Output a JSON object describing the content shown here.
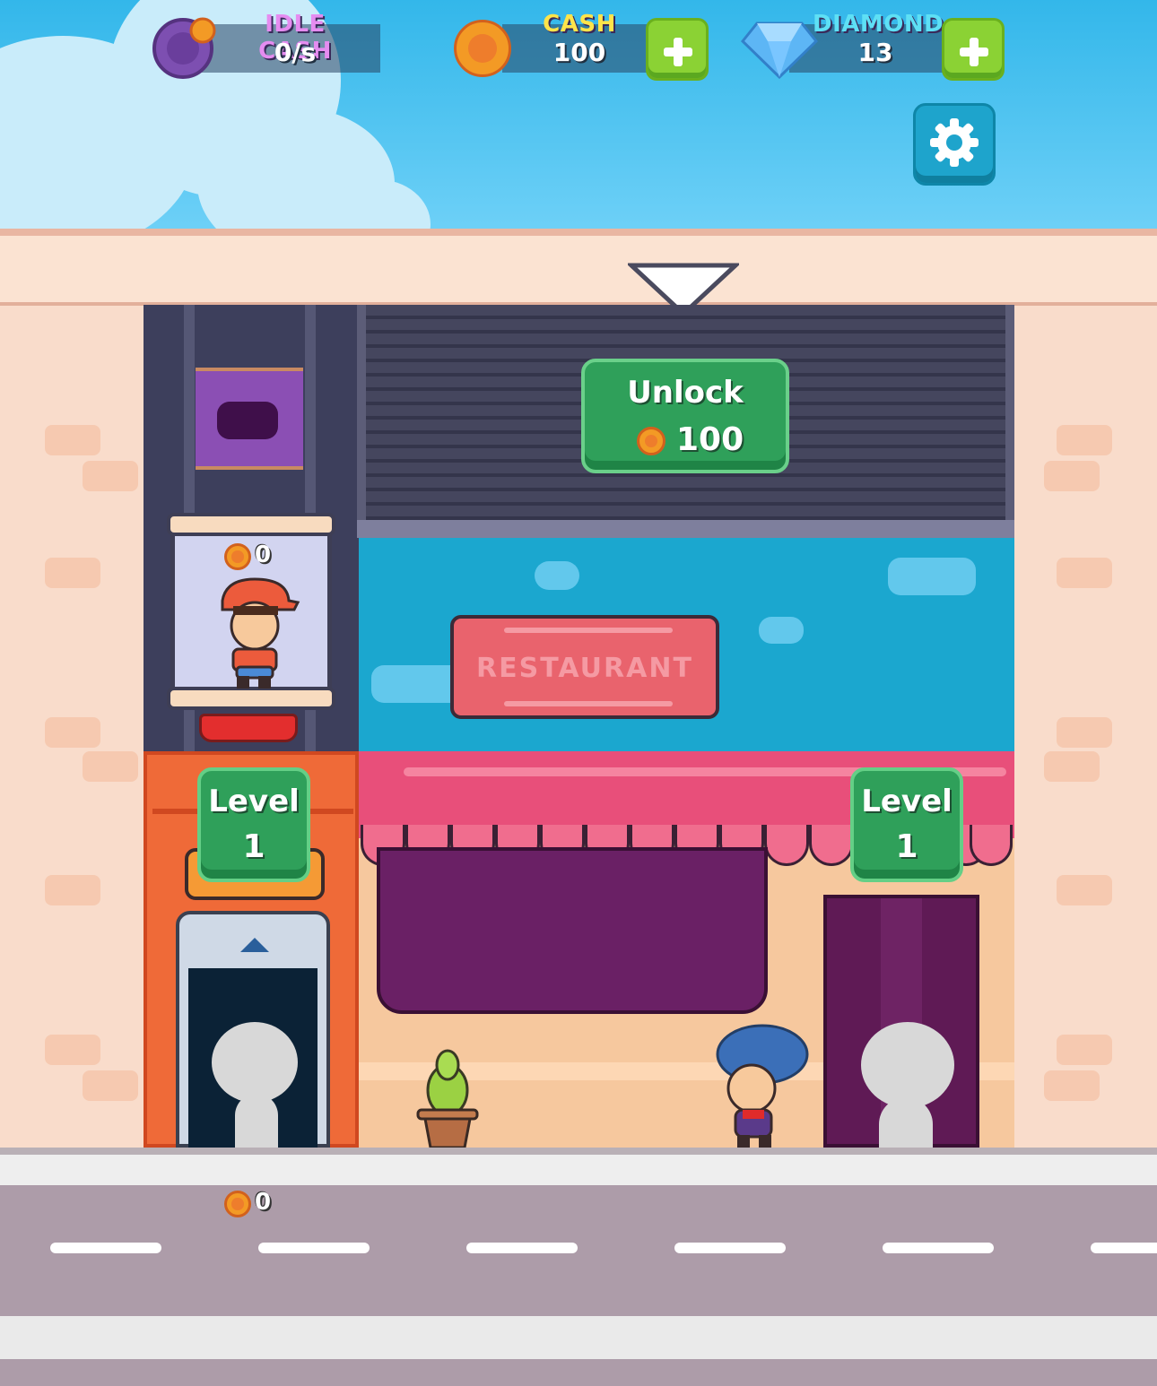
{
  "hud": {
    "idle_cash": {
      "label": "IDLE CASH",
      "value": "0/s",
      "label_color": "#e58cf0"
    },
    "cash": {
      "label": "CASH",
      "value": "100",
      "label_color": "#ffe44a"
    },
    "diamond": {
      "label": "DIAMOND",
      "value": "13",
      "label_color": "#5ee0f5"
    }
  },
  "unlock": {
    "label": "Unlock",
    "price": "100"
  },
  "elevator": {
    "car_count": "0"
  },
  "restaurant": {
    "sign": "RESTAURANT"
  },
  "levels": {
    "elevator_level": {
      "label": "Level",
      "value": "1"
    },
    "restaurant_level": {
      "label": "Level",
      "value": "1"
    }
  },
  "street": {
    "coin_count": "0"
  },
  "icons": [
    "clock-coin-icon",
    "cash-coin-icon",
    "diamond-icon",
    "plus-icon",
    "gear-icon",
    "coin-icon",
    "arrow-up-icon"
  ],
  "colors": {
    "accent_green": "#2fa05a",
    "sky": "#33b7ea",
    "awning": "#e84f7a"
  }
}
